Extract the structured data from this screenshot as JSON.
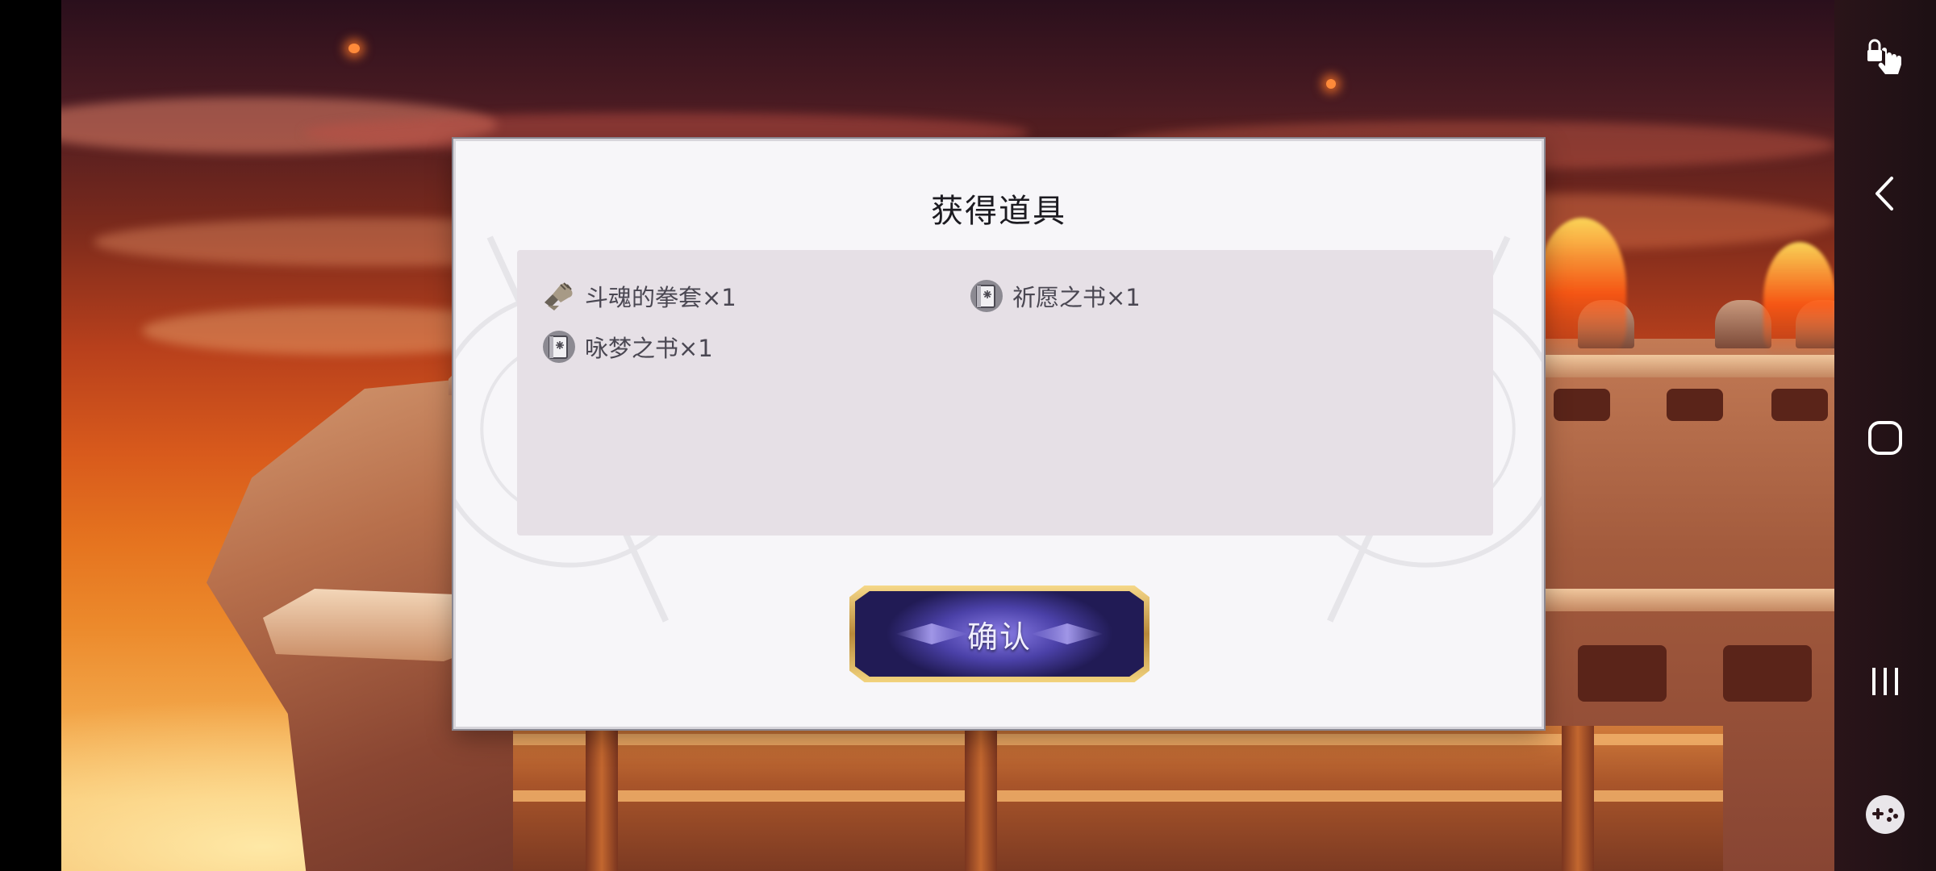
{
  "dialog": {
    "title": "获得道具",
    "items": [
      {
        "label": "斗魂的拳套×1",
        "icon": "gauntlet-icon"
      },
      {
        "label": "祈愿之书×1",
        "icon": "book-icon"
      },
      {
        "label": "咏梦之书×1",
        "icon": "book-icon"
      }
    ],
    "confirm_label": "确认"
  },
  "nav": {
    "buttons": [
      "touch-lock-icon",
      "back-icon",
      "home-icon",
      "recents-icon",
      "game-tools-icon"
    ]
  },
  "colors": {
    "dialog_bg": "#f7f6f9",
    "panel_bg": "#e6e0e6",
    "confirm_accent": "#4b41a8",
    "confirm_border": "#d9b35e"
  }
}
